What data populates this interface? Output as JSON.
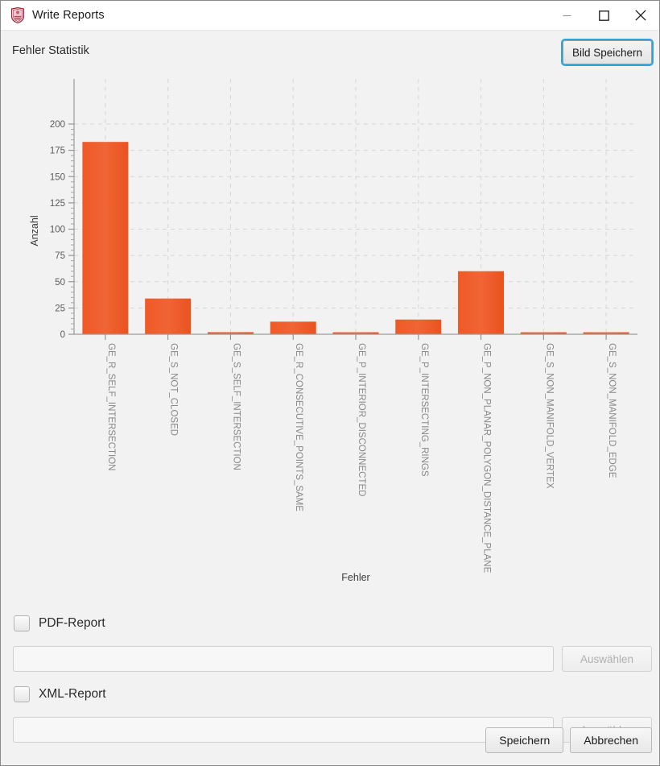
{
  "window": {
    "title": "Write Reports",
    "icon": "shield-icon",
    "controls": {
      "minimize": "minimize-icon",
      "maximize": "maximize-icon",
      "close": "close-icon"
    }
  },
  "header": {
    "section_title": "Fehler Statistik",
    "save_image_label": "Bild Speichern"
  },
  "chart_data": {
    "type": "bar",
    "title": "",
    "xlabel": "Fehler",
    "ylabel": "Anzahl",
    "ylim": [
      0,
      200
    ],
    "yticks": [
      0,
      25,
      50,
      75,
      100,
      125,
      150,
      175,
      200
    ],
    "grid": true,
    "legend": false,
    "bar_color": "#f05a28",
    "categories": [
      "GE_R_SELF_INTERSECTION",
      "GE_S_NOT_CLOSED",
      "GE_S_SELF_INTERSECTION",
      "GE_R_CONSECUTIVE_POINTS_SAME",
      "GE_P_INTERIOR_DISCONNECTED",
      "GE_P_INTERSECTING_RINGS",
      "GE_P_NON_PLANAR_POLYGON_DISTANCE_PLANE",
      "GE_S_NON_MANIFOLD_VERTEX",
      "GE_S_NON_MANIFOLD_EDGE"
    ],
    "values": [
      183,
      34,
      2,
      12,
      1,
      14,
      60,
      1,
      1
    ]
  },
  "form": {
    "pdf": {
      "label": "PDF-Report",
      "checked": false,
      "path_value": "",
      "path_placeholder": "",
      "browse_label": "Auswählen",
      "browse_enabled": false
    },
    "xml": {
      "label": "XML-Report",
      "checked": false,
      "path_value": "",
      "path_placeholder": "",
      "browse_label": "Auswählen",
      "browse_enabled": false
    }
  },
  "footer": {
    "save_label": "Speichern",
    "cancel_label": "Abbrechen"
  }
}
